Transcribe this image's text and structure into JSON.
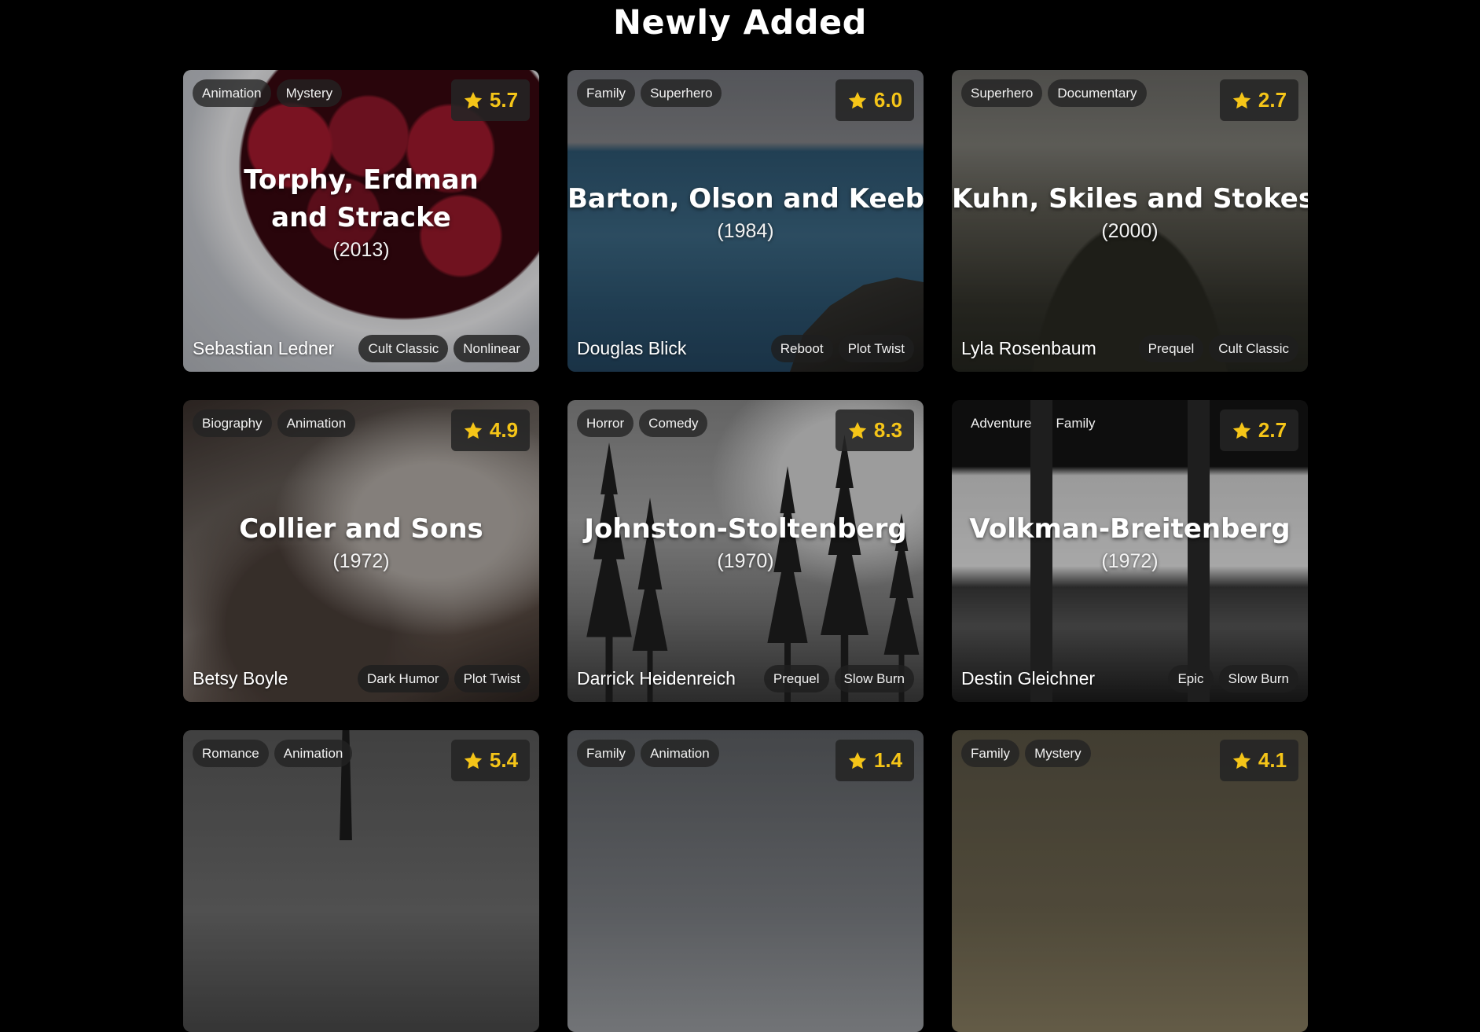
{
  "page": {
    "title": "Newly Added"
  },
  "colors": {
    "background": "#000000",
    "rating": "#f5c518",
    "tag_bg": "#222222"
  },
  "cards": [
    {
      "genres": [
        "Animation",
        "Mystery"
      ],
      "rating": "5.7",
      "title": "Torphy, Erdman and Stracke",
      "year": "(2013)",
      "director": "Sebastian Ledner",
      "tags": [
        "Cult Classic",
        "Nonlinear"
      ]
    },
    {
      "genres": [
        "Family",
        "Superhero"
      ],
      "rating": "6.0",
      "title": "Barton, Olson and Keebler",
      "year": "(1984)",
      "director": "Douglas Blick",
      "tags": [
        "Reboot",
        "Plot Twist"
      ]
    },
    {
      "genres": [
        "Superhero",
        "Documentary"
      ],
      "rating": "2.7",
      "title": "Kuhn, Skiles and Stokes",
      "year": "(2000)",
      "director": "Lyla Rosenbaum",
      "tags": [
        "Prequel",
        "Cult Classic"
      ]
    },
    {
      "genres": [
        "Biography",
        "Animation"
      ],
      "rating": "4.9",
      "title": "Collier and Sons",
      "year": "(1972)",
      "director": "Betsy Boyle",
      "tags": [
        "Dark Humor",
        "Plot Twist"
      ]
    },
    {
      "genres": [
        "Horror",
        "Comedy"
      ],
      "rating": "8.3",
      "title": "Johnston-Stoltenberg",
      "year": "(1970)",
      "director": "Darrick Heidenreich",
      "tags": [
        "Prequel",
        "Slow Burn"
      ]
    },
    {
      "genres": [
        "Adventure",
        "Family"
      ],
      "rating": "2.7",
      "title": "Volkman-Breitenberg",
      "year": "(1972)",
      "director": "Destin Gleichner",
      "tags": [
        "Epic",
        "Slow Burn"
      ]
    },
    {
      "genres": [
        "Romance",
        "Animation"
      ],
      "rating": "5.4"
    },
    {
      "genres": [
        "Family",
        "Animation"
      ],
      "rating": "1.4"
    },
    {
      "genres": [
        "Family",
        "Mystery"
      ],
      "rating": "4.1"
    }
  ]
}
